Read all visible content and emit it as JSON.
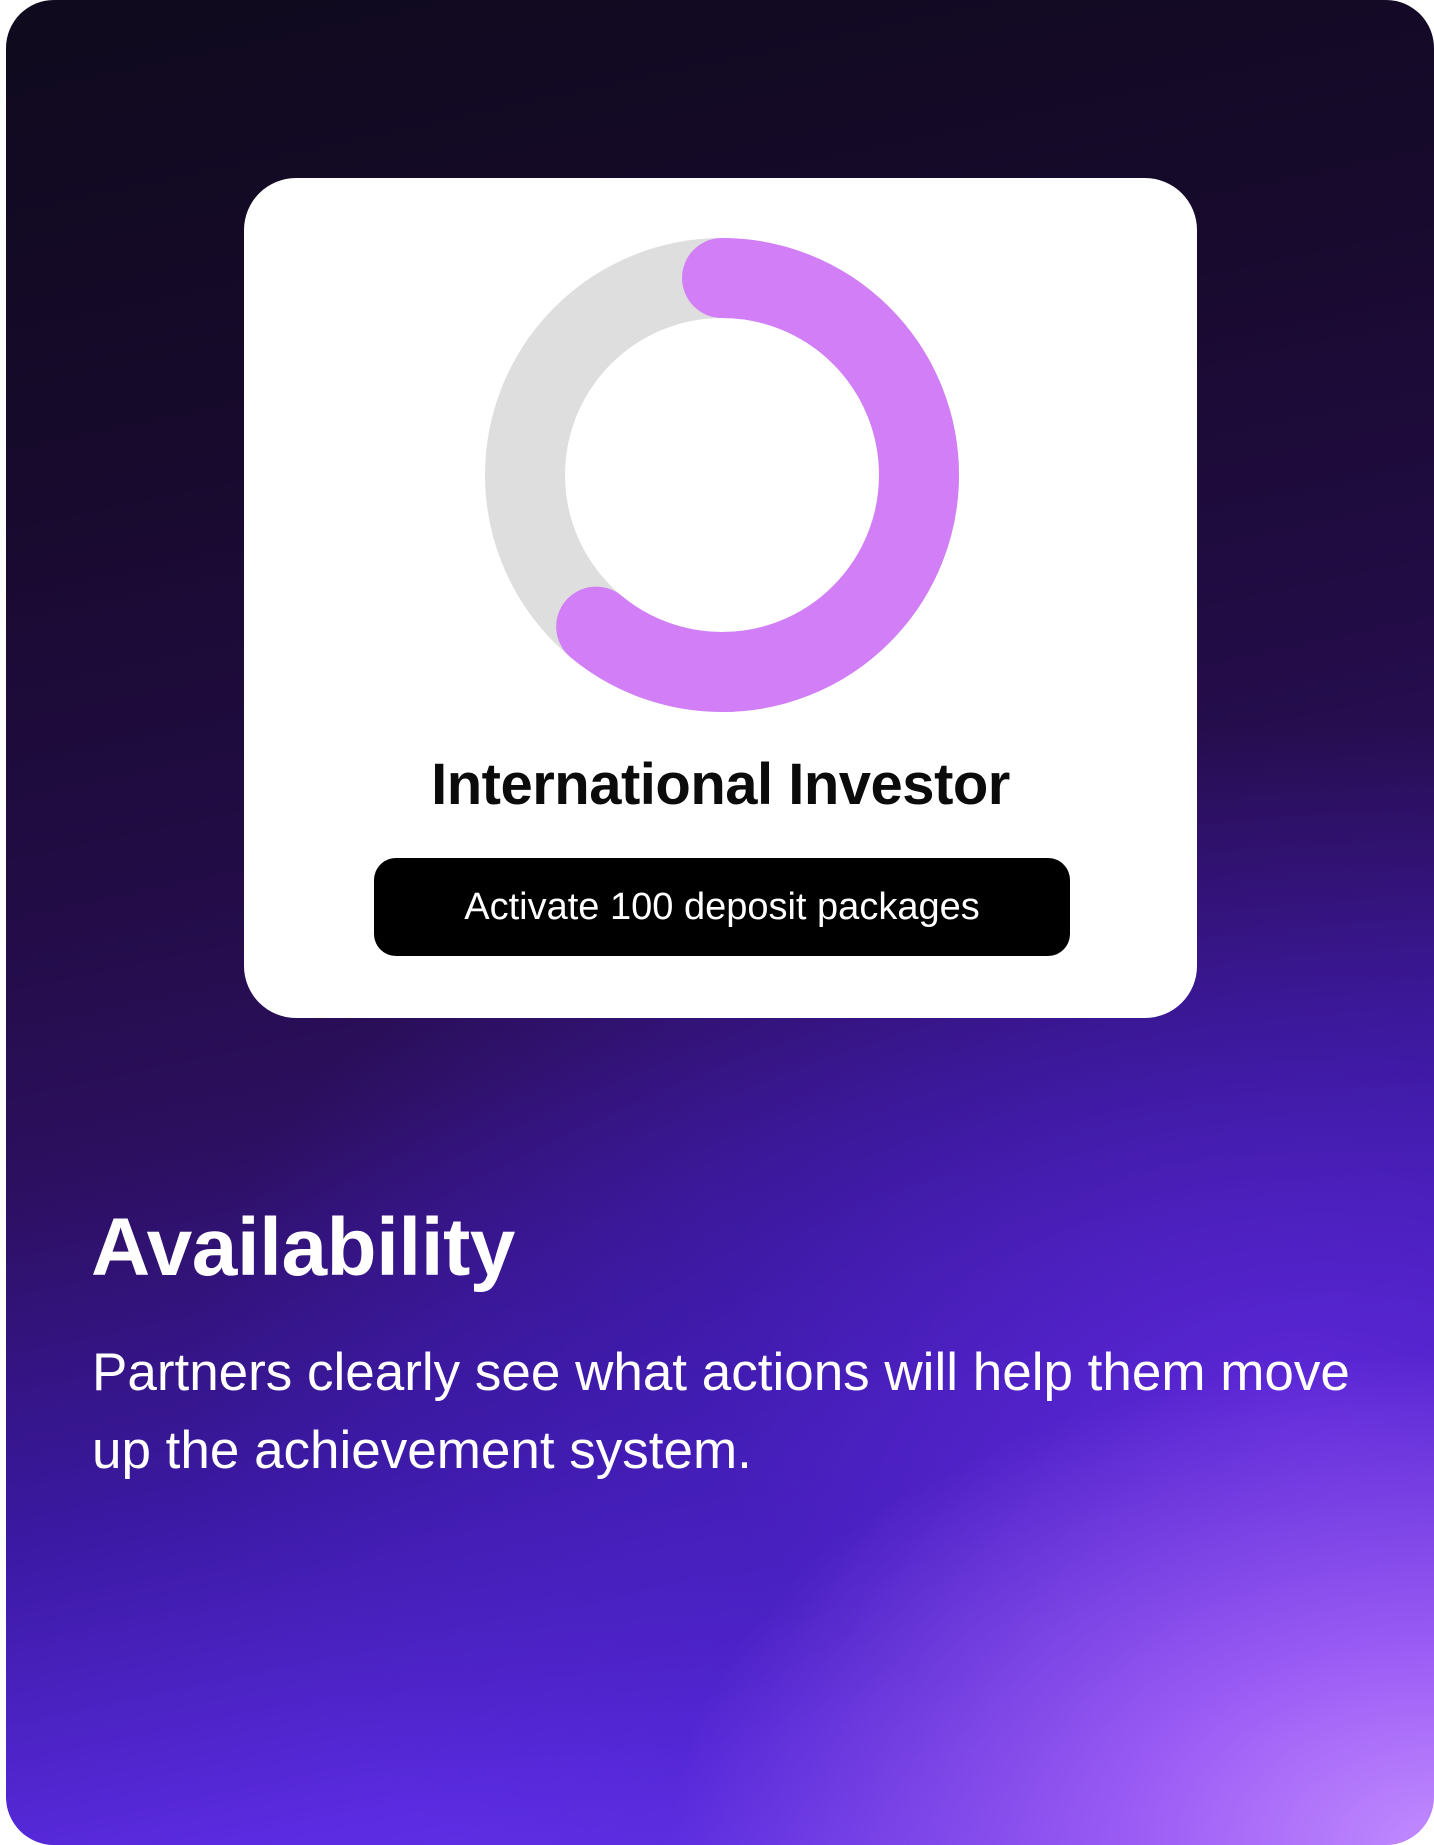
{
  "achievement": {
    "title": "International Investor",
    "task": "Activate 100 deposit packages",
    "progress": 0.61,
    "progress_color": "#d17ef7",
    "track_color": "#dedede"
  },
  "section": {
    "heading": "Availability",
    "description": "Partners clearly see what actions will help them move up the achievement system."
  },
  "colors": {
    "card_background": "#ffffff",
    "pill_background": "#000000",
    "text_light": "#ffffff",
    "text_dark": "#0b0b0b"
  }
}
